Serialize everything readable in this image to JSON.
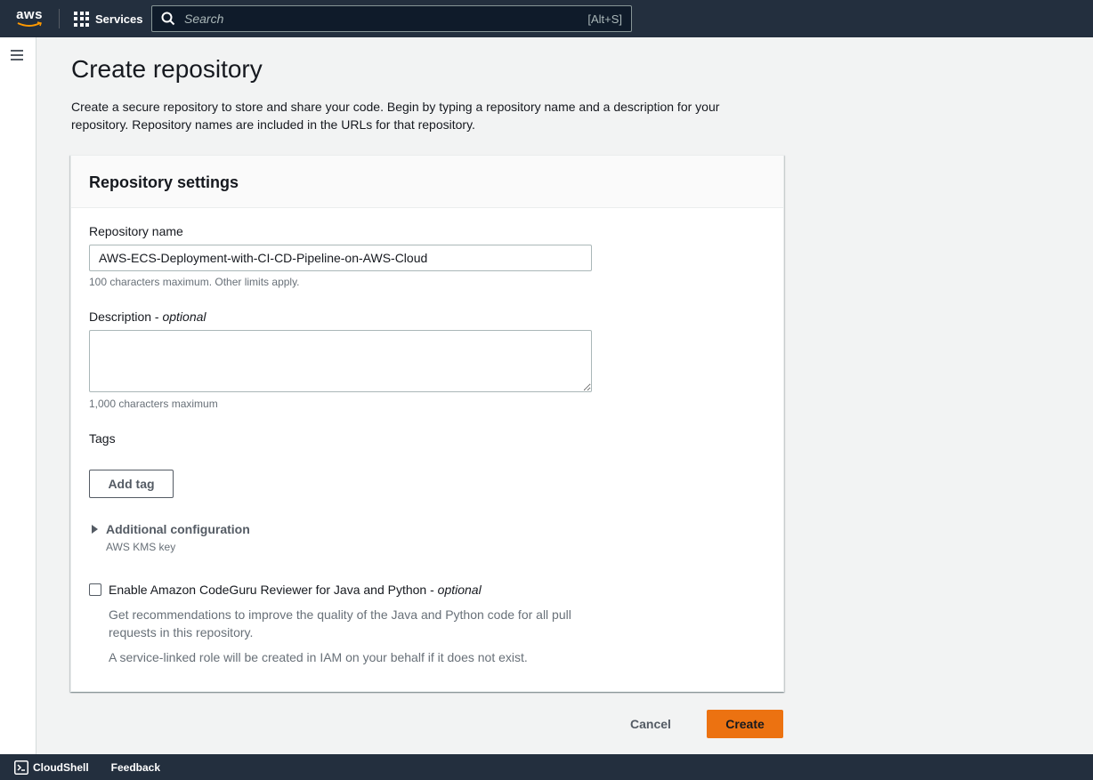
{
  "topnav": {
    "logo_text": "aws",
    "services_label": "Services",
    "search_placeholder": "Search",
    "search_shortcut": "[Alt+S]"
  },
  "page": {
    "title": "Create repository",
    "description": "Create a secure repository to store and share your code. Begin by typing a repository name and a description for your repository. Repository names are included in the URLs for that repository."
  },
  "panel": {
    "title": "Repository settings",
    "repo_name_label": "Repository name",
    "repo_name_value": "AWS-ECS-Deployment-with-CI-CD-Pipeline-on-AWS-Cloud",
    "repo_name_hint": "100 characters maximum. Other limits apply.",
    "description_label": "Description - ",
    "description_optional": "optional",
    "description_value": "",
    "description_hint": "1,000 characters maximum",
    "tags_label": "Tags",
    "add_tag_button": "Add tag",
    "additional_config_label": "Additional configuration",
    "additional_config_hint": "AWS KMS key",
    "codeguru_label": "Enable Amazon CodeGuru Reviewer for Java and Python - ",
    "codeguru_optional": "optional",
    "codeguru_checked": false,
    "codeguru_desc": "Get recommendations to improve the quality of the Java and Python code for all pull requests in this repository.",
    "codeguru_note": "A service-linked role will be created in IAM on your behalf if it does not exist."
  },
  "actions": {
    "cancel": "Cancel",
    "create": "Create"
  },
  "bottombar": {
    "cloudshell": "CloudShell",
    "feedback": "Feedback"
  },
  "colors": {
    "nav_bg": "#232f3e",
    "primary_button": "#ec7211"
  }
}
